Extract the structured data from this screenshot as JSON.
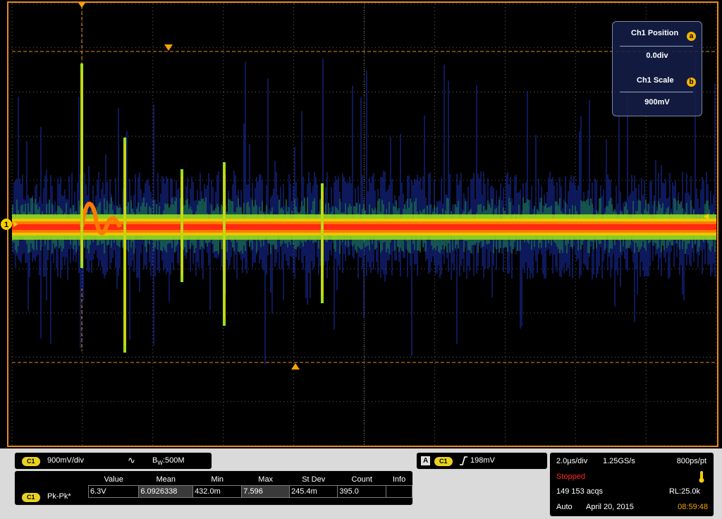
{
  "ch_panel": {
    "position_label": "Ch1 Position",
    "position_value": "0.0div",
    "position_knob": "a",
    "scale_label": "Ch1 Scale",
    "scale_value": "900mV",
    "scale_knob": "b"
  },
  "channel": {
    "badge": "C1",
    "scale": "900mV/div",
    "coupling_icon": "ac-coupling-icon",
    "coupling_symbol": "∿",
    "bandwidth_label": "B",
    "bandwidth_sub": "W",
    "bandwidth_value": ":500M",
    "marker": "1"
  },
  "trigger": {
    "mode_badge": "A",
    "source_badge": "C1",
    "slope_icon": "rising-edge-icon",
    "level": "198mV"
  },
  "measurements": {
    "headers": [
      "Value",
      "Mean",
      "Min",
      "Max",
      "St Dev",
      "Count",
      "Info"
    ],
    "row": {
      "badge": "C1",
      "name": "Pk-Pk*",
      "value": "6.3V",
      "mean": "6.0926338",
      "min": "432.0m",
      "max": "7.596",
      "stdev": "245.4m",
      "count": "395.0",
      "info": ""
    }
  },
  "acquisition": {
    "timebase": "2.0µs/div",
    "sample_rate": "1.25GS/s",
    "resolution": "800ps/pt",
    "status": "Stopped",
    "acqs": "149 153 acqs",
    "record_length": "RL:25.0k",
    "mode": "Auto",
    "date": "April 20, 2015",
    "time": "08:59:48"
  },
  "colors": {
    "grid": "#8a8a8a",
    "cursor": "#e88a1c",
    "status_red": "#ff2a1a",
    "time_orange": "#f5a400",
    "badge_yellow": "#e9d21f"
  }
}
